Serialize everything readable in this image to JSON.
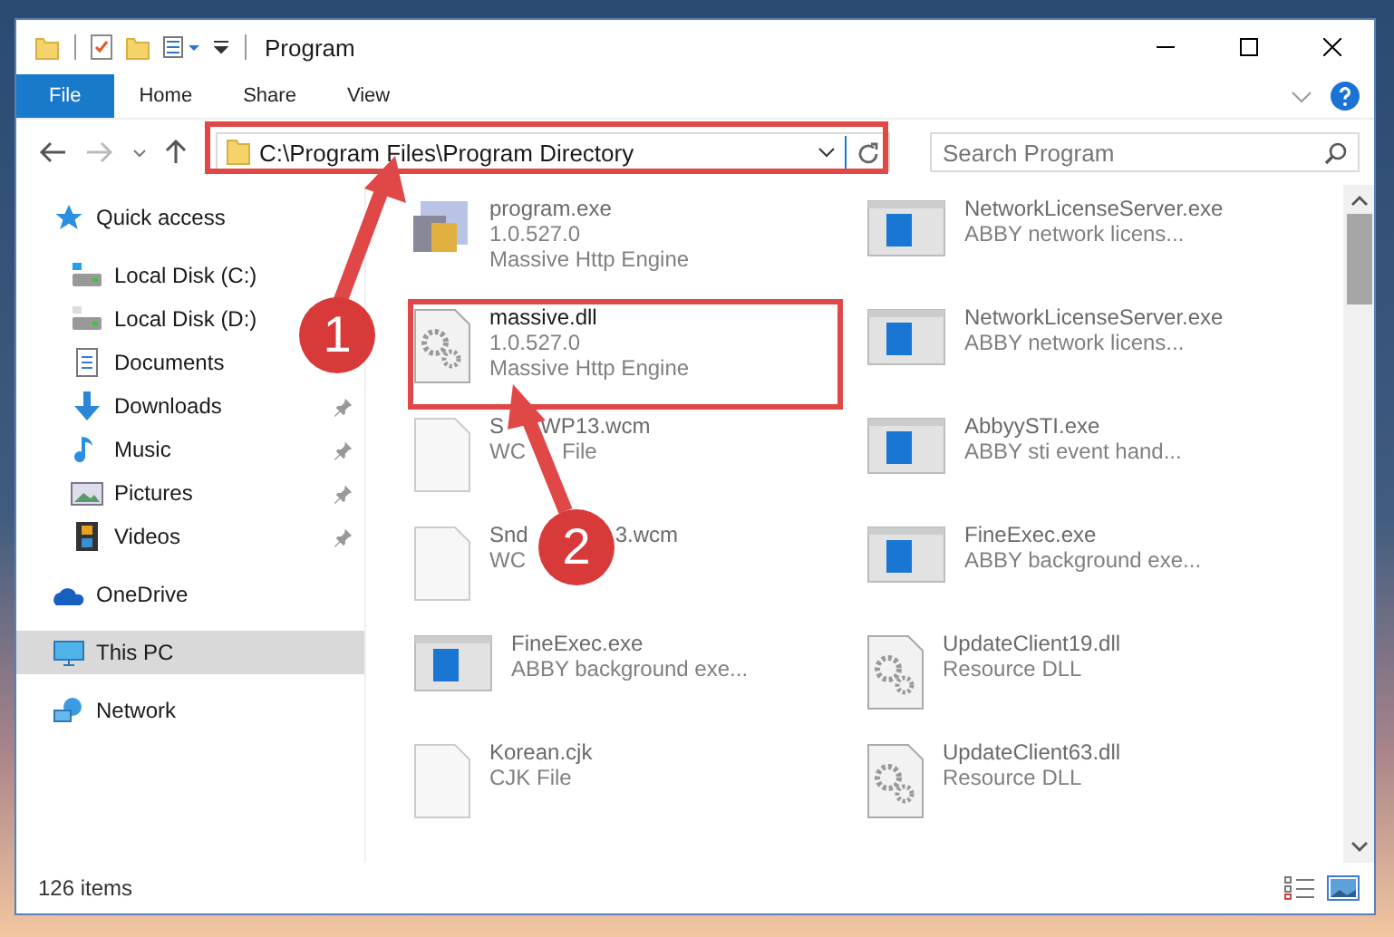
{
  "window": {
    "title": "Program"
  },
  "ribbon": {
    "tabs": [
      {
        "label": "File",
        "kind": "file"
      },
      {
        "label": "Home",
        "kind": "tab"
      },
      {
        "label": "Share",
        "kind": "tab"
      },
      {
        "label": "View",
        "kind": "tab"
      }
    ]
  },
  "address": {
    "path": "C:\\Program Files\\Program Directory"
  },
  "search": {
    "placeholder": "Search Program"
  },
  "sidebar": {
    "items": [
      {
        "label": "Quick access",
        "selected": false,
        "children": [
          {
            "label": "Local Disk (C:)",
            "selected": false,
            "pinned": false
          },
          {
            "label": "Local Disk (D:)",
            "selected": false,
            "pinned": false
          },
          {
            "label": "Documents",
            "selected": false,
            "pinned": false
          },
          {
            "label": "Downloads",
            "selected": false,
            "pinned": true
          },
          {
            "label": "Music",
            "selected": false,
            "pinned": true
          },
          {
            "label": "Pictures",
            "selected": false,
            "pinned": true
          },
          {
            "label": "Videos",
            "selected": false,
            "pinned": true
          }
        ]
      },
      {
        "label": "OneDrive",
        "selected": false
      },
      {
        "label": "This PC",
        "selected": true
      },
      {
        "label": "Network",
        "selected": false
      }
    ]
  },
  "files": [
    {
      "name": [
        "program.exe"
      ],
      "details": [
        [
          "1.0.527.0"
        ],
        [
          "Massive Http Engine"
        ]
      ],
      "kind": "program",
      "dimmed": true
    },
    {
      "name": [
        "massive.dll"
      ],
      "details": [
        [
          "1.0.527.0"
        ],
        [
          "Massive Http Engine"
        ]
      ],
      "kind": "dll",
      "dimmed": false
    },
    {
      "name": [
        "S",
        "WP13.wcm"
      ],
      "details": [
        [
          "WC",
          "File"
        ]
      ],
      "kind": "blank",
      "dimmed": true
    },
    {
      "name": [
        "Snd",
        "3.wcm"
      ],
      "details": [
        [
          "WC"
        ]
      ],
      "kind": "blank",
      "dimmed": true
    },
    {
      "name": [
        "FineExec.exe"
      ],
      "details": [
        [
          "ABBY background exe..."
        ]
      ],
      "kind": "app",
      "dimmed": true
    },
    {
      "name": [
        "Korean.cjk"
      ],
      "details": [
        [
          "CJK File"
        ]
      ],
      "kind": "blank",
      "dimmed": true
    },
    {
      "name": [
        "NetworkLicenseServer.exe"
      ],
      "details": [
        [
          "ABBY network licens..."
        ]
      ],
      "kind": "app",
      "dimmed": true
    },
    {
      "name": [
        "NetworkLicenseServer.exe"
      ],
      "details": [
        [
          "ABBY network licens..."
        ]
      ],
      "kind": "app",
      "dimmed": true
    },
    {
      "name": [
        "AbbyySTI.exe"
      ],
      "details": [
        [
          "ABBY sti event hand..."
        ]
      ],
      "kind": "app",
      "dimmed": true
    },
    {
      "name": [
        "FineExec.exe"
      ],
      "details": [
        [
          "ABBY background exe..."
        ]
      ],
      "kind": "app",
      "dimmed": true
    },
    {
      "name": [
        "UpdateClient19.dll"
      ],
      "details": [
        [
          "Resource DLL"
        ]
      ],
      "kind": "dll",
      "dimmed": true
    },
    {
      "name": [
        "UpdateClient63.dll"
      ],
      "details": [
        [
          "Resource DLL"
        ]
      ],
      "kind": "dll",
      "dimmed": true
    }
  ],
  "status_bar": {
    "count": "126 items"
  },
  "annotations": [
    {
      "number": "1"
    },
    {
      "number": "2"
    }
  ]
}
